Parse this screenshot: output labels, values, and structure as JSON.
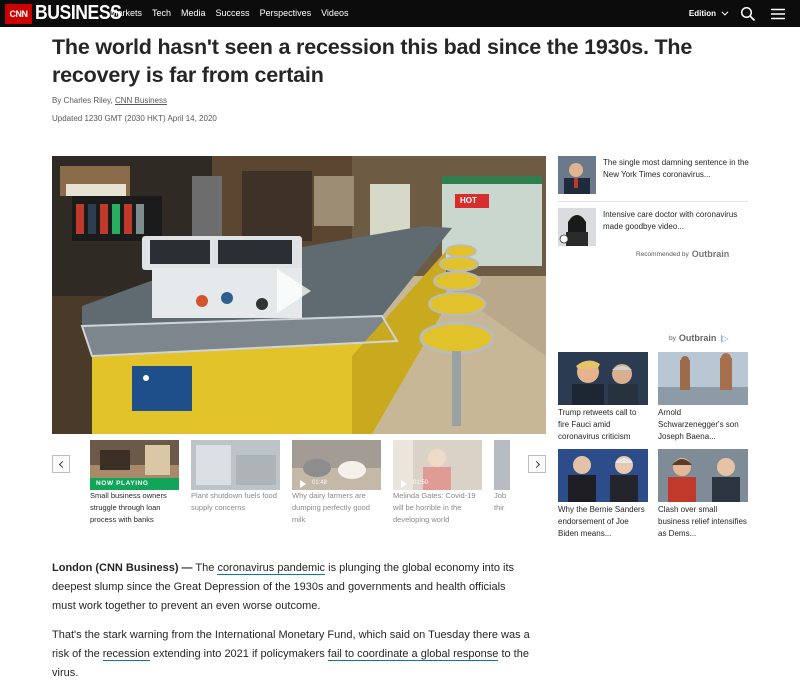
{
  "nav": {
    "logo_cnn": "CNN",
    "logo_business": "BUSINESS",
    "links": [
      "Markets",
      "Tech",
      "Media",
      "Success",
      "Perspectives",
      "Videos"
    ],
    "edition": "Edition",
    "icons": [
      "search-icon",
      "menu-icon"
    ]
  },
  "article": {
    "headline": "The world hasn't seen a recession this bad since the 1930s. The recovery is far from certain",
    "byline_prefix": "By Charles Riley, ",
    "byline_link": "CNN Business",
    "updated": "Updated 1230 GMT (2030 HKT) April 14, 2020",
    "hot_sign": "HOT",
    "p1": {
      "dateline": "London (CNN Business) —",
      "t1": " The ",
      "link1": "coronavirus pandemic",
      "t2": " is plunging the global economy into its deepest slump since the Great Depression of the 1930s and governments and health officials must work together to prevent an even worse outcome."
    },
    "p2": {
      "t1": "That's the stark warning from the International Monetary Fund, which said on Tuesday there was a risk of the ",
      "link1": "recession",
      "t2": " extending into 2021 if policymakers ",
      "link2": "fail to coordinate a global response",
      "t3": " to the virus."
    }
  },
  "carousel": {
    "items": [
      {
        "caption": "Small business owners struggle through loan process with banks",
        "badge": "NOW PLAYING",
        "duration": ""
      },
      {
        "caption": "Plant shutdown fuels food supply concerns",
        "badge": "",
        "duration": ""
      },
      {
        "caption": "Why dairy farmers are dumping perfectly good milk",
        "badge": "",
        "duration": "01:48"
      },
      {
        "caption": "Melinda Gates: Covid-19 will be horrible in the developing world",
        "badge": "",
        "duration": "01:50"
      },
      {
        "caption": "Job thir",
        "badge": "",
        "duration": ""
      }
    ]
  },
  "rail": {
    "recommended": [
      {
        "text": "The single most damning sentence in the New York Times coronavirus..."
      },
      {
        "text": "Intensive care doctor with coronavirus made goodbye video..."
      }
    ],
    "recommended_by": "Recommended by",
    "outbrain": "Outbrain",
    "by": "by",
    "cards": [
      {
        "caption": "Trump retweets call to fire Fauci amid coronavirus criticism"
      },
      {
        "caption": "Arnold Schwarzenegger's son Joseph Baena..."
      },
      {
        "caption": "Why the Bernie Sanders endorsement of Joe Biden means..."
      },
      {
        "caption": "Clash over small business relief intensifies as Dems..."
      }
    ]
  },
  "colors": {
    "nav_bg": "#0c0c0c",
    "cnn_red": "#cc0000",
    "now_playing_green": "#10a558",
    "link_underline": "#0c79a3"
  }
}
